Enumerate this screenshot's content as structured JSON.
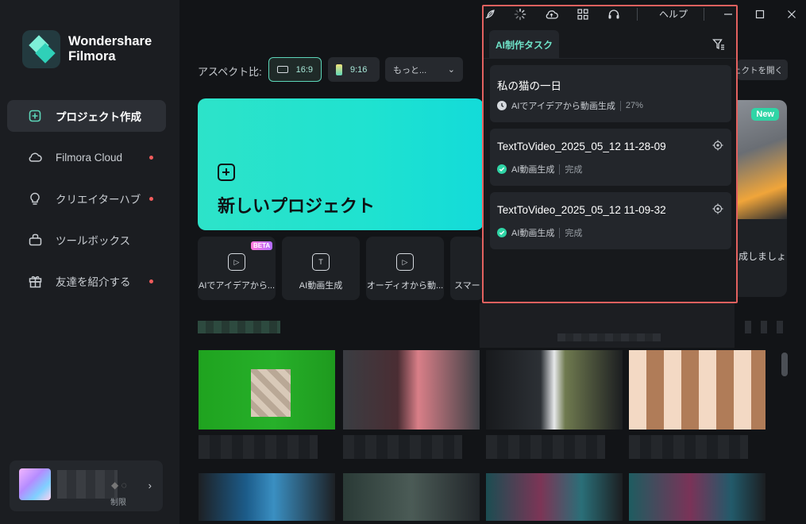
{
  "app": {
    "brand_line1": "Wondershare",
    "brand_line2": "Filmora"
  },
  "sidebar": {
    "items": [
      {
        "label": "プロジェクト作成",
        "icon": "plus-square-icon",
        "active": true,
        "dot": false
      },
      {
        "label": "Filmora Cloud",
        "icon": "cloud-icon",
        "active": false,
        "dot": true
      },
      {
        "label": "クリエイターハブ",
        "icon": "lightbulb-icon",
        "active": false,
        "dot": true
      },
      {
        "label": "ツールボックス",
        "icon": "toolbox-icon",
        "active": false,
        "dot": false
      },
      {
        "label": "友達を紹介する",
        "icon": "gift-icon",
        "active": false,
        "dot": true
      }
    ],
    "account": {
      "limit_text": "制限"
    }
  },
  "main": {
    "aspect_label": "アスペクト比:",
    "aspect_options": [
      {
        "label": "16:9",
        "selected": true
      },
      {
        "label": "9:16",
        "selected": false
      }
    ],
    "more_label": "もっと...",
    "open_project_label": "ジェクトを開く",
    "new_project_label": "新しいプロジェクト",
    "tools": [
      {
        "label": "AIでアイデアから...",
        "badge": "BETA",
        "icon": "ai-idea-video-icon"
      },
      {
        "label": "AI動画生成",
        "badge": "",
        "icon": "text-to-video-icon"
      },
      {
        "label": "オーディオから動...",
        "badge": "",
        "icon": "audio-to-video-icon"
      },
      {
        "label": "スマート",
        "badge": "",
        "icon": "smart-icon"
      }
    ],
    "promo": {
      "badge": "New",
      "text": "成しましょ"
    }
  },
  "titlebar": {
    "help_label": "ヘルプ"
  },
  "task_panel": {
    "tab_label": "AI制作タスク",
    "tasks": [
      {
        "title": "私の猫の一日",
        "type": "AIでアイデアから動画生成",
        "status": "27%",
        "state": "progress",
        "show_locate": false
      },
      {
        "title": "TextToVideo_2025_05_12 11-28-09",
        "type": "AI動画生成",
        "status": "完成",
        "state": "done",
        "show_locate": true
      },
      {
        "title": "TextToVideo_2025_05_12 11-09-32",
        "type": "AI動画生成",
        "status": "完成",
        "state": "done",
        "show_locate": true
      }
    ]
  },
  "colors": {
    "accent": "#5dd6b9",
    "highlight_border": "#e3615f",
    "notification_dot": "#f25c5c",
    "success": "#2fd5a6"
  }
}
